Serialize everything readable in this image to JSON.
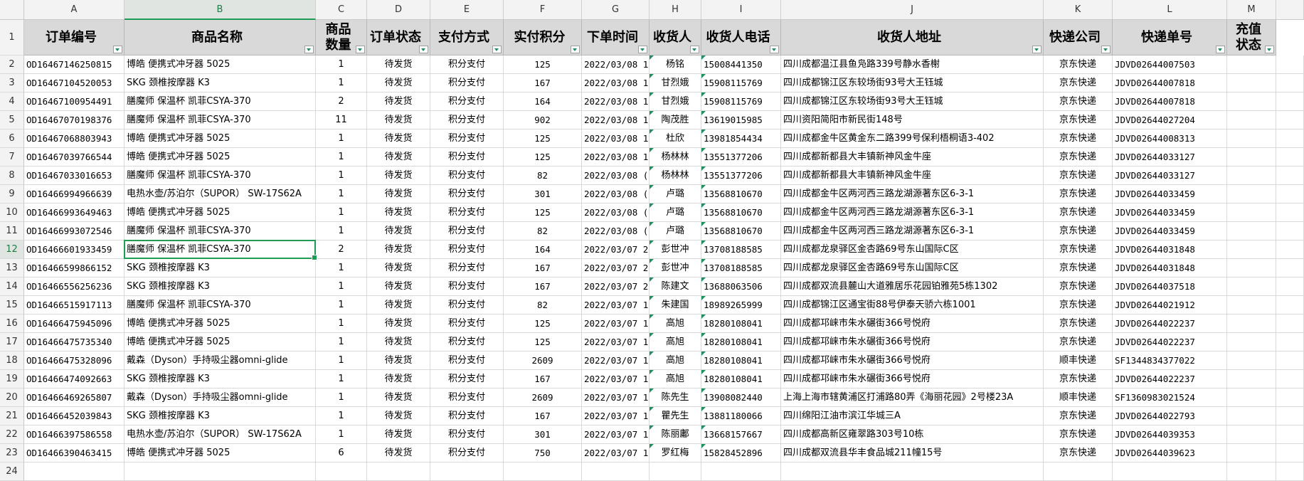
{
  "columns": [
    "A",
    "B",
    "C",
    "D",
    "E",
    "F",
    "G",
    "H",
    "I",
    "J",
    "K",
    "L",
    "M"
  ],
  "headers": [
    "订单编号",
    "商品名称",
    "商品数量",
    "订单状态",
    "支付方式",
    "实付积分",
    "下单时间",
    "收货人",
    "收货人电话",
    "收货人地址",
    "快递公司",
    "快递单号",
    "充值状态"
  ],
  "row_numbers": [
    "1",
    "2",
    "3",
    "4",
    "5",
    "6",
    "7",
    "8",
    "9",
    "10",
    "11",
    "12",
    "13",
    "14",
    "15",
    "16",
    "17",
    "18",
    "19",
    "20",
    "21",
    "22",
    "23",
    "24"
  ],
  "active_cell": {
    "column": "B",
    "row": "12"
  },
  "rows": [
    [
      "OD16467146250815",
      "博皓 便携式冲牙器 5025",
      "1",
      "待发货",
      "积分支付",
      "125",
      "2022/03/08 1",
      "杨铭",
      "15008441350",
      "四川成都温江县鱼凫路339号静水香榭",
      "京东快递",
      "JDVD02644007503",
      ""
    ],
    [
      "OD16467104520053",
      "SKG 颈椎按摩器 K3",
      "1",
      "待发货",
      "积分支付",
      "167",
      "2022/03/08 1",
      "甘烈娥",
      "15908115769",
      "四川成都锦江区东较场街93号大王钰城",
      "京东快递",
      "JDVD02644007818",
      ""
    ],
    [
      "OD16467100954491",
      "膳魔师 保温杯 凯菲CSYA-370",
      "2",
      "待发货",
      "积分支付",
      "164",
      "2022/03/08 1",
      "甘烈娥",
      "15908115769",
      "四川成都锦江区东较场街93号大王钰城",
      "京东快递",
      "JDVD02644007818",
      ""
    ],
    [
      "OD16467070198376",
      "膳魔师 保温杯 凯菲CSYA-370",
      "11",
      "待发货",
      "积分支付",
      "902",
      "2022/03/08 1",
      "陶茂胜",
      "13619015985",
      "四川资阳简阳市新民街148号",
      "京东快递",
      "JDVD02644027204",
      ""
    ],
    [
      "OD16467068803943",
      "博皓 便携式冲牙器 5025",
      "1",
      "待发货",
      "积分支付",
      "125",
      "2022/03/08 1",
      "杜欣",
      "13981854434",
      "四川成都金牛区黄金东二路399号保利梧桐语3-402",
      "京东快递",
      "JDVD02644008313",
      ""
    ],
    [
      "OD16467039766544",
      "博皓 便携式冲牙器 5025",
      "1",
      "待发货",
      "积分支付",
      "125",
      "2022/03/08 1",
      "杨林林",
      "13551377206",
      "四川成都新都县大丰镇新神风金牛座",
      "京东快递",
      "JDVD02644033127",
      ""
    ],
    [
      "OD16467033016653",
      "膳魔师 保温杯 凯菲CSYA-370",
      "1",
      "待发货",
      "积分支付",
      "82",
      "2022/03/08 (",
      "杨林林",
      "13551377206",
      "四川成都新都县大丰镇新神风金牛座",
      "京东快递",
      "JDVD02644033127",
      ""
    ],
    [
      "OD16466994966639",
      "电热水壶/苏泊尔（SUPOR） SW-17S62A",
      "1",
      "待发货",
      "积分支付",
      "301",
      "2022/03/08 (",
      "卢璐",
      "13568810670",
      "四川成都金牛区两河西三路龙湖源著东区6-3-1",
      "京东快递",
      "JDVD02644033459",
      ""
    ],
    [
      "OD16466993649463",
      "博皓 便携式冲牙器 5025",
      "1",
      "待发货",
      "积分支付",
      "125",
      "2022/03/08 (",
      "卢璐",
      "13568810670",
      "四川成都金牛区两河西三路龙湖源著东区6-3-1",
      "京东快递",
      "JDVD02644033459",
      ""
    ],
    [
      "OD16466993072546",
      "膳魔师 保温杯 凯菲CSYA-370",
      "1",
      "待发货",
      "积分支付",
      "82",
      "2022/03/08 (",
      "卢璐",
      "13568810670",
      "四川成都金牛区两河西三路龙湖源著东区6-3-1",
      "京东快递",
      "JDVD02644033459",
      ""
    ],
    [
      "OD16466601933459",
      "膳魔师 保温杯 凯菲CSYA-370",
      "2",
      "待发货",
      "积分支付",
      "164",
      "2022/03/07 2",
      "彭世冲",
      "13708188585",
      "四川成都龙泉驿区金杏路69号东山国际C区",
      "京东快递",
      "JDVD02644031848",
      ""
    ],
    [
      "OD16466599866152",
      "SKG 颈椎按摩器 K3",
      "1",
      "待发货",
      "积分支付",
      "167",
      "2022/03/07 2",
      "彭世冲",
      "13708188585",
      "四川成都龙泉驿区金杏路69号东山国际C区",
      "京东快递",
      "JDVD02644031848",
      ""
    ],
    [
      "OD16466556256236",
      "SKG 颈椎按摩器 K3",
      "1",
      "待发货",
      "积分支付",
      "167",
      "2022/03/07 2",
      "陈建文",
      "13688063506",
      "四川成都双流县麓山大道雅居乐花园铂雅苑5栋1302",
      "京东快递",
      "JDVD02644037518",
      ""
    ],
    [
      "OD16466515917113",
      "膳魔师 保温杯 凯菲CSYA-370",
      "1",
      "待发货",
      "积分支付",
      "82",
      "2022/03/07 1",
      "朱建国",
      "18989265999",
      "四川成都锦江区通宝街88号伊泰天骄六栋1001",
      "京东快递",
      "JDVD02644021912",
      ""
    ],
    [
      "OD16466475945096",
      "博皓 便携式冲牙器 5025",
      "1",
      "待发货",
      "积分支付",
      "125",
      "2022/03/07 1",
      "高旭",
      "18280108041",
      "四川成都邛崃市朱水碾街366号悦府",
      "京东快递",
      "JDVD02644022237",
      ""
    ],
    [
      "OD16466475735340",
      "博皓 便携式冲牙器 5025",
      "1",
      "待发货",
      "积分支付",
      "125",
      "2022/03/07 1",
      "高旭",
      "18280108041",
      "四川成都邛崃市朱水碾街366号悦府",
      "京东快递",
      "JDVD02644022237",
      ""
    ],
    [
      "OD16466475328096",
      "戴森（Dyson）手持吸尘器omni-glide",
      "1",
      "待发货",
      "积分支付",
      "2609",
      "2022/03/07 1",
      "高旭",
      "18280108041",
      "四川成都邛崃市朱水碾街366号悦府",
      "顺丰快递",
      "SF1344834377022",
      ""
    ],
    [
      "OD16466474092663",
      "SKG 颈椎按摩器 K3",
      "1",
      "待发货",
      "积分支付",
      "167",
      "2022/03/07 1",
      "高旭",
      "18280108041",
      "四川成都邛崃市朱水碾街366号悦府",
      "京东快递",
      "JDVD02644022237",
      ""
    ],
    [
      "OD16466469265807",
      "戴森（Dyson）手持吸尘器omni-glide",
      "1",
      "待发货",
      "积分支付",
      "2609",
      "2022/03/07 1",
      "陈先生",
      "13908082440",
      "上海上海市辖黄浦区打浦路80弄《海丽花园》2号楼23A",
      "顺丰快递",
      "SF1360983021524",
      ""
    ],
    [
      "OD16466452039843",
      "SKG 颈椎按摩器 K3",
      "1",
      "待发货",
      "积分支付",
      "167",
      "2022/03/07 1",
      "瞿先生",
      "13881180066",
      "四川绵阳江油市滨江华城三A",
      "京东快递",
      "JDVD02644022793",
      ""
    ],
    [
      "OD16466397586558",
      "电热水壶/苏泊尔（SUPOR） SW-17S62A",
      "1",
      "待发货",
      "积分支付",
      "301",
      "2022/03/07 1",
      "陈丽鄘",
      "13668157667",
      "四川成都高新区雍翠路303号10栋",
      "京东快递",
      "JDVD02644039353",
      ""
    ],
    [
      "OD16466390463415",
      "博皓 便携式冲牙器 5025",
      "6",
      "待发货",
      "积分支付",
      "750",
      "2022/03/07 1",
      "罗红梅",
      "15828452896",
      "四川成都双流县华丰食品城211幢15号",
      "京东快递",
      "JDVD02644039623",
      ""
    ]
  ]
}
